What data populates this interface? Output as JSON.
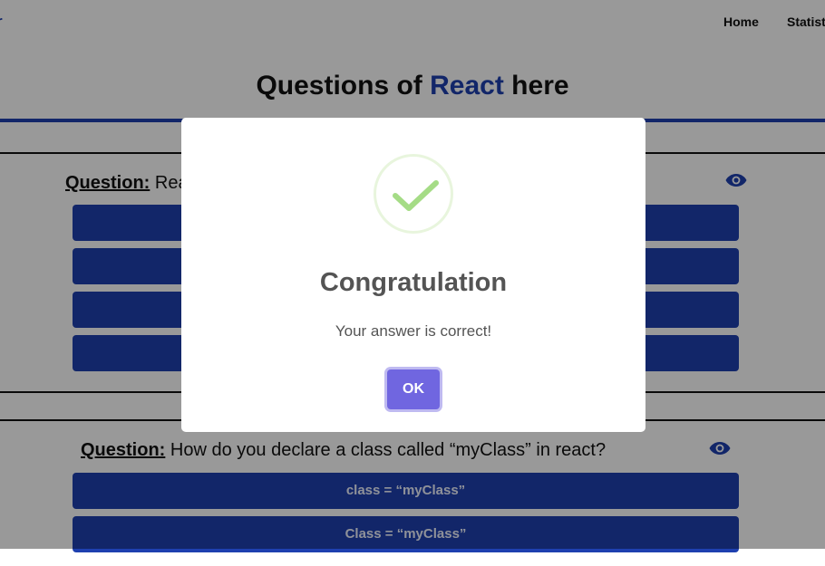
{
  "nav": {
    "brand": "r",
    "links": [
      "Home",
      "Statistics"
    ]
  },
  "header": {
    "prefix": "Questions of ",
    "topic": "React",
    "suffix": " here"
  },
  "questions": [
    {
      "label": "Question:",
      "text": "Rea",
      "options": [
        "",
        "",
        "",
        ""
      ]
    },
    {
      "label": "Question:",
      "text": "How do you declare a class called “myClass” in react?",
      "options": [
        "class = “myClass”",
        "Class = “myClass”"
      ]
    }
  ],
  "modal": {
    "title": "Congratulation",
    "text": "Your answer is correct!",
    "ok_label": "OK"
  },
  "colors": {
    "primary": "#1e40af",
    "success_check": "#a5dc86",
    "confirm_button": "#7066e0"
  },
  "icons": {
    "reveal": "eye-icon",
    "success": "check-icon"
  }
}
